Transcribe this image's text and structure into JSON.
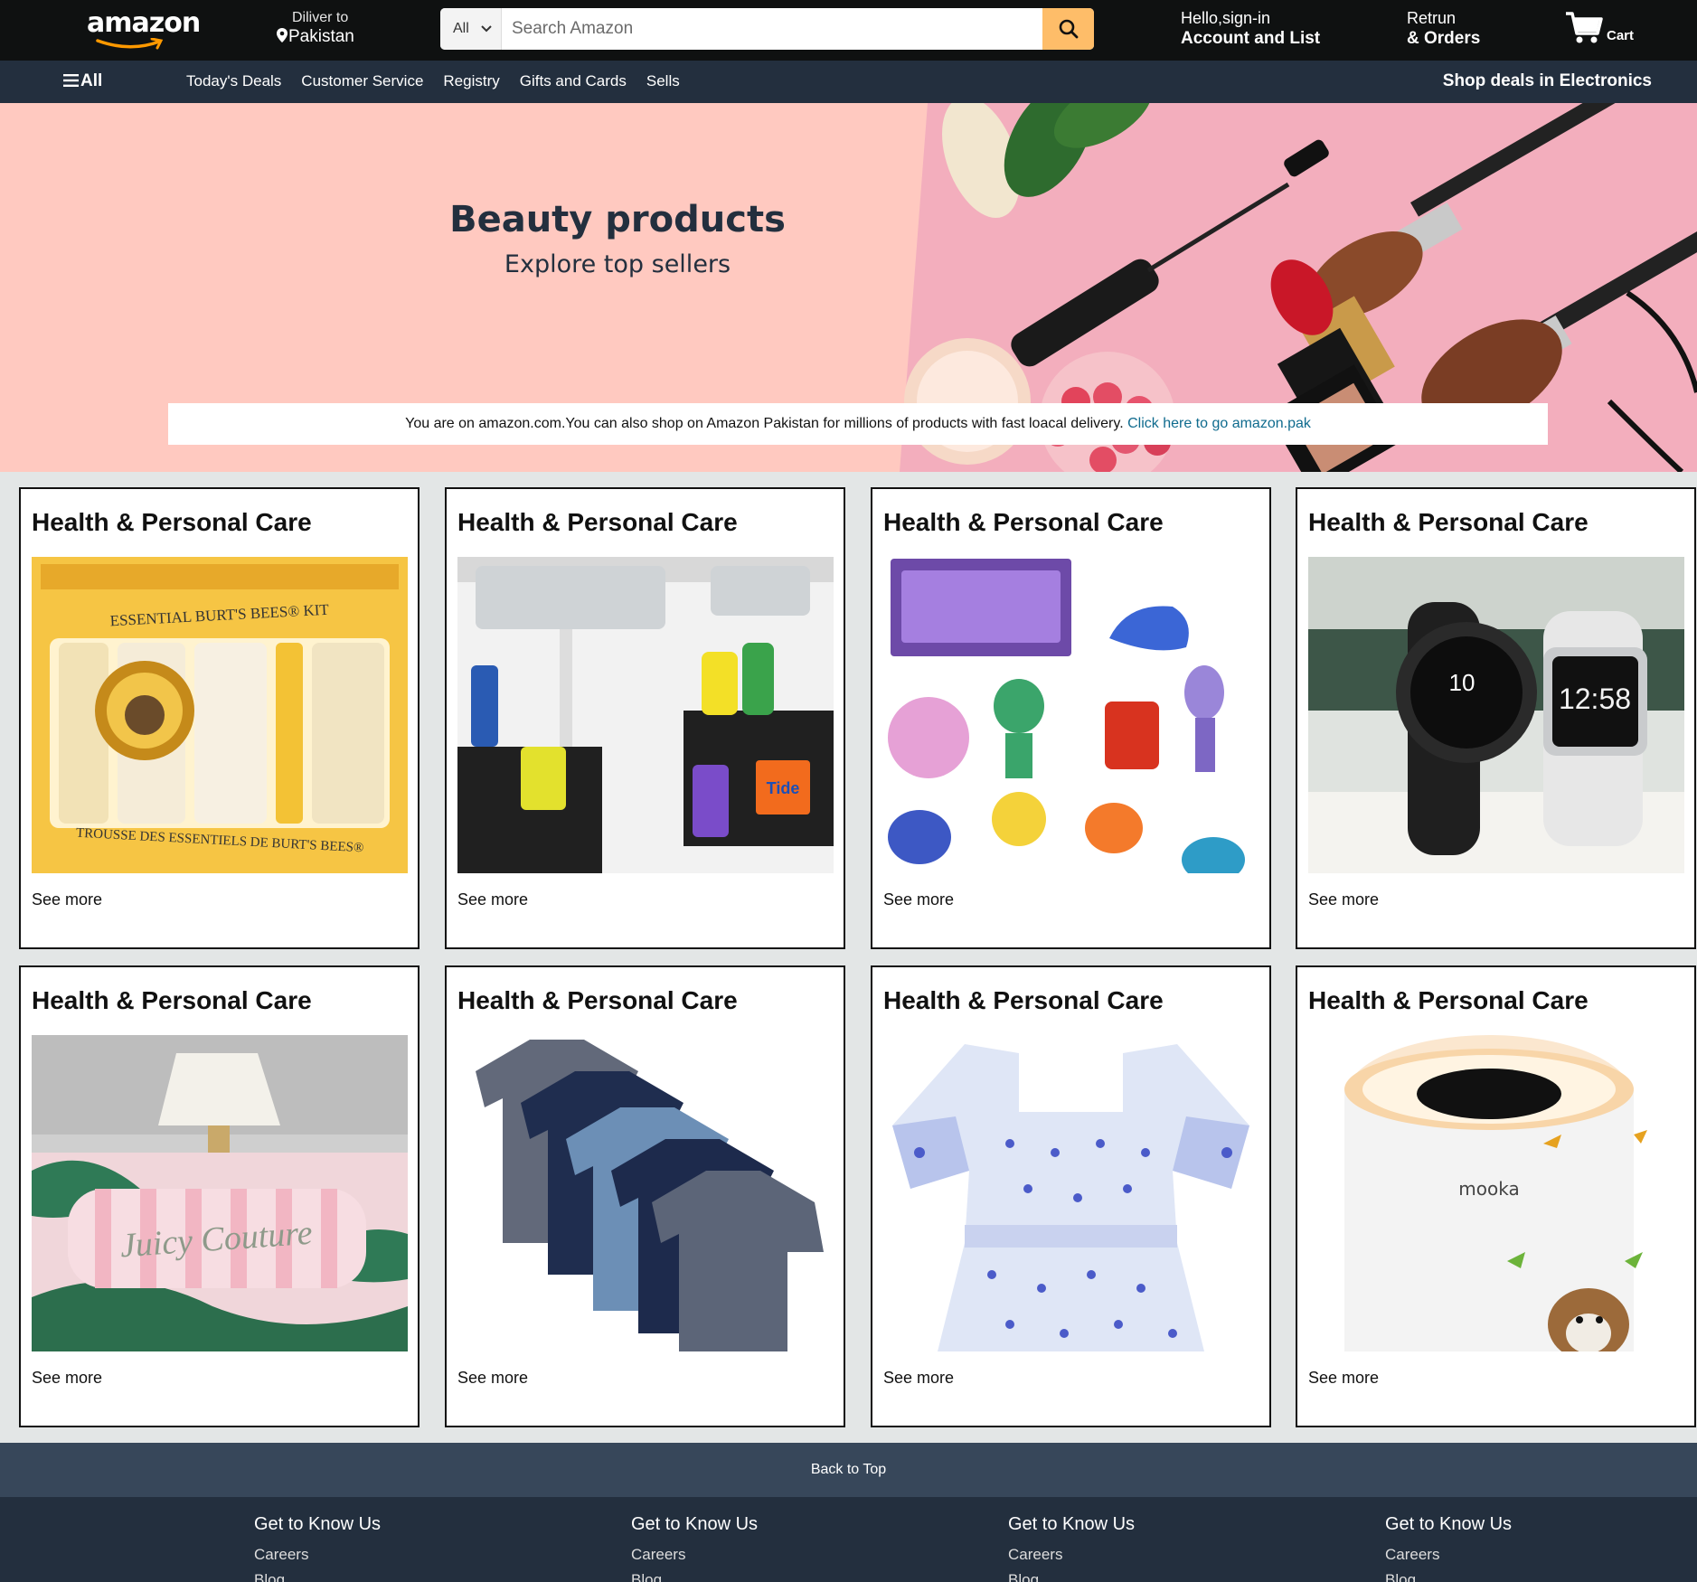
{
  "header": {
    "logo": "amazon",
    "deliver_label": "Diliver to",
    "deliver_location": "Pakistan",
    "search_category": "All",
    "search_placeholder": "Search Amazon",
    "account_greeting": "Hello,sign-in",
    "account_label": "Account and List",
    "orders_line1": "Retrun",
    "orders_line2": "& Orders",
    "cart_label": "Cart"
  },
  "nav": {
    "all_label": "All",
    "links": [
      "Today's Deals",
      "Customer Service",
      "Registry",
      "Gifts and Cards",
      "Sells"
    ],
    "promo": "Shop deals in Electronics"
  },
  "hero": {
    "title": "Beauty products",
    "subtitle": "Explore top sellers",
    "notice_text": "You are on amazon.com.You can also shop on Amazon Pakistan for millions of products with fast loacal delivery.",
    "notice_link": "Click here to go amazon.pak"
  },
  "cards": [
    {
      "title": "Health & Personal Care",
      "link": "See more",
      "image": "burts-bees-kit"
    },
    {
      "title": "Health & Personal Care",
      "link": "See more",
      "image": "under-sink-organizer"
    },
    {
      "title": "Health & Personal Care",
      "link": "See more",
      "image": "inside-out-figures"
    },
    {
      "title": "Health & Personal Care",
      "link": "See more",
      "image": "smartwatches"
    },
    {
      "title": "Health & Personal Care",
      "link": "See more",
      "image": "bedding-pillow"
    },
    {
      "title": "Health & Personal Care",
      "link": "See more",
      "image": "t-shirts"
    },
    {
      "title": "Health & Personal Care",
      "link": "See more",
      "image": "girls-dress"
    },
    {
      "title": "Health & Personal Care",
      "link": "See more",
      "image": "air-purifier"
    }
  ],
  "image_text": {
    "kit_top": "ESSENTIAL BURT'S BEES® KIT",
    "kit_bottom": "TROUSSE DES ESSENTIELS DE BURT'S BEES®",
    "watch_time_1": "10",
    "watch_time_2": "12:58",
    "purifier_brand": "mooka",
    "pillow_text": "Juicy Couture",
    "detergent_brand": "Tide"
  },
  "footer": {
    "back_to_top": "Back to Top",
    "columns": [
      {
        "heading": "Get to Know Us",
        "links": [
          "Careers",
          "Blog"
        ]
      },
      {
        "heading": "Get to Know Us",
        "links": [
          "Careers",
          "Blog"
        ]
      },
      {
        "heading": "Get to Know Us",
        "links": [
          "Careers",
          "Blog"
        ]
      },
      {
        "heading": "Get to Know Us",
        "links": [
          "Careers",
          "Blog"
        ]
      }
    ]
  },
  "colors": {
    "header_bg": "#0f1111",
    "nav_bg": "#232f3e",
    "search_button": "#febd69",
    "hero_bg": "#ffc9c0",
    "page_bg": "#e3e6e6",
    "link": "#0f6b8e",
    "back_to_top_bg": "#37475a"
  }
}
